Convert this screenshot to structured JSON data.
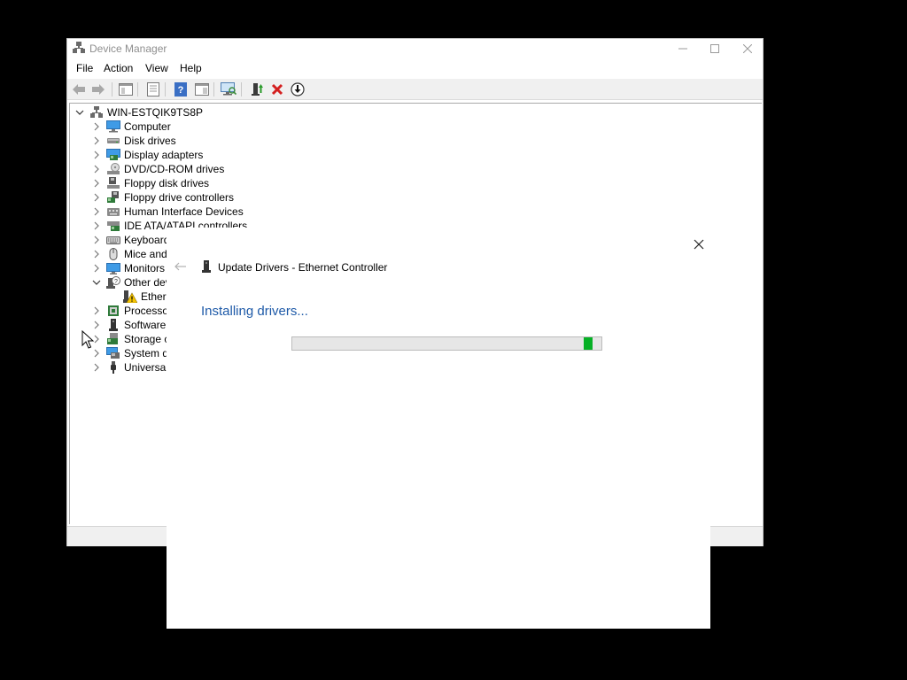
{
  "window": {
    "title": "Device Manager",
    "controls": [
      "minimize",
      "maximize",
      "close"
    ]
  },
  "menu": {
    "file": "File",
    "action": "Action",
    "view": "View",
    "help": "Help"
  },
  "toolbar": {
    "icons": [
      "back-arrow-icon",
      "forward-arrow-icon",
      "show-hide-console-tree-icon",
      "properties-icon",
      "help-icon",
      "action-pane-icon",
      "scan-hardware-icon",
      "update-driver-icon",
      "uninstall-device-icon",
      "disable-device-icon"
    ]
  },
  "tree": {
    "root": "WIN-ESTQIK9TS8P",
    "items": [
      {
        "label": "Computer",
        "icon": "computer-icon",
        "expanded": false
      },
      {
        "label": "Disk drives",
        "icon": "disk-drive-icon",
        "expanded": false
      },
      {
        "label": "Display adapters",
        "icon": "display-adapter-icon",
        "expanded": false
      },
      {
        "label": "DVD/CD-ROM drives",
        "icon": "dvd-drive-icon",
        "expanded": false
      },
      {
        "label": "Floppy disk drives",
        "icon": "floppy-disk-icon",
        "expanded": false
      },
      {
        "label": "Floppy drive controllers",
        "icon": "floppy-controller-icon",
        "expanded": false
      },
      {
        "label": "Human Interface Devices",
        "icon": "hid-icon",
        "expanded": false
      },
      {
        "label": "IDE ATA/ATAPI controllers",
        "icon": "ide-controller-icon",
        "expanded": false
      },
      {
        "label": "Keyboards",
        "icon": "keyboard-icon",
        "expanded": false
      },
      {
        "label": "Mice and c",
        "icon": "mouse-icon",
        "expanded": false
      },
      {
        "label": "Monitors",
        "icon": "monitor-icon",
        "expanded": false
      },
      {
        "label": "Other devi",
        "icon": "unknown-device-icon",
        "expanded": true
      },
      {
        "label": "Ethern",
        "icon": "warning-device-icon",
        "child": true
      },
      {
        "label": "Processors",
        "icon": "processor-icon",
        "expanded": false
      },
      {
        "label": "Software d",
        "icon": "software-device-icon",
        "expanded": false
      },
      {
        "label": "Storage co",
        "icon": "storage-controller-icon",
        "expanded": false
      },
      {
        "label": "System de",
        "icon": "system-device-icon",
        "expanded": false
      },
      {
        "label": "Universal S",
        "icon": "usb-icon",
        "expanded": false
      }
    ]
  },
  "dialog": {
    "title": "Update Drivers - Ethernet Controller",
    "status": "Installing drivers...",
    "progress_fraction": 0.97,
    "progress_segment_fraction": 0.026
  },
  "colors": {
    "progress_green": "#06b025",
    "status_blue": "#1e5aa8",
    "desktop": "#000000"
  }
}
